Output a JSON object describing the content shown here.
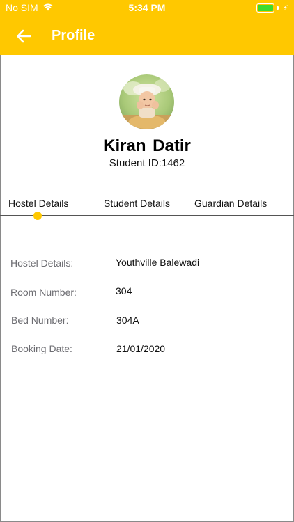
{
  "status_bar": {
    "carrier": "No SIM",
    "time": "5:34 PM",
    "battery_level": 1.0
  },
  "nav": {
    "title": "Profile",
    "back_icon": "arrow-left-icon"
  },
  "profile": {
    "name": "Kiran  Datir",
    "student_id": "Student ID:1462"
  },
  "tabs": [
    {
      "label": "Hostel Details",
      "selected": true
    },
    {
      "label": "Student Details",
      "selected": false
    },
    {
      "label": "Guardian Details",
      "selected": false
    }
  ],
  "details": [
    {
      "label": "Hostel Details:",
      "value": "Youthville Balewadi"
    },
    {
      "label": "Room Number:",
      "value": "304"
    },
    {
      "label": "Bed Number:",
      "value": "304A"
    },
    {
      "label": "Booking Date:",
      "value": "21/01/2020"
    }
  ],
  "colors": {
    "accent": "#ffc800",
    "label": "#6d6d72",
    "battery": "#3ddc2e"
  }
}
